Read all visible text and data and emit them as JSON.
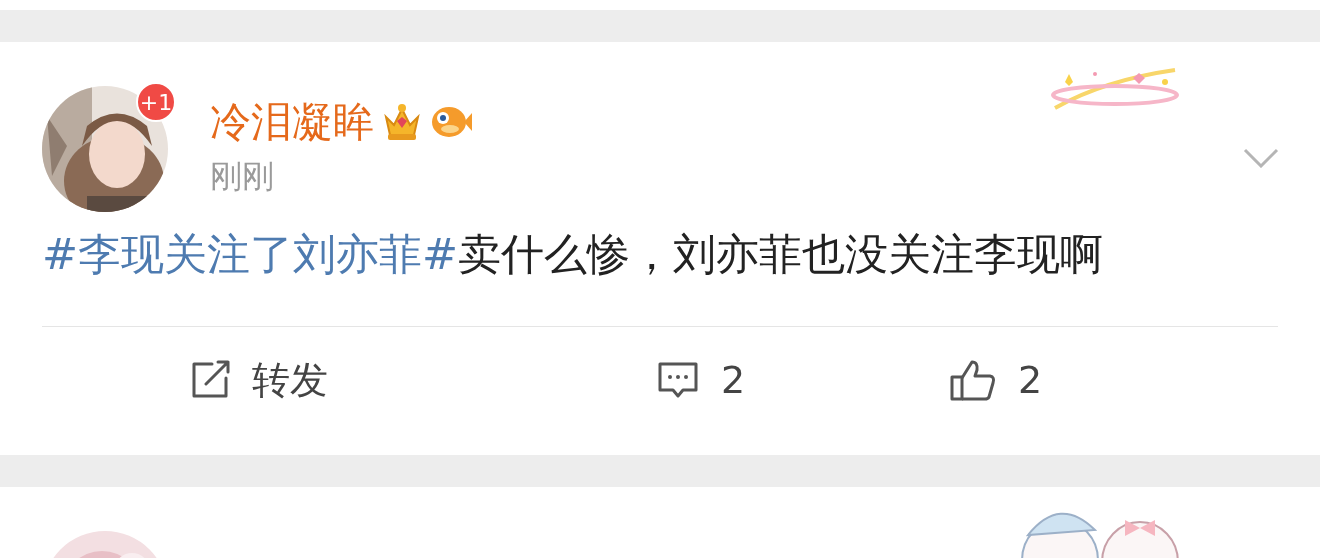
{
  "posts": [
    {
      "kind": "full",
      "author": {
        "name": "冷泪凝眸",
        "badge": "+1"
      },
      "time": "刚刚",
      "content": [
        {
          "kind": "topic",
          "text": "#李现关注了刘亦菲#"
        },
        {
          "kind": "plain",
          "text": "卖什么惨，刘亦菲也没关注李现啊"
        }
      ],
      "actions": [
        {
          "kind": "repost",
          "label": "转发"
        },
        {
          "kind": "comment",
          "label": "2"
        },
        {
          "kind": "like",
          "label": "2"
        }
      ]
    },
    {
      "kind": "cut_off"
    }
  ]
}
